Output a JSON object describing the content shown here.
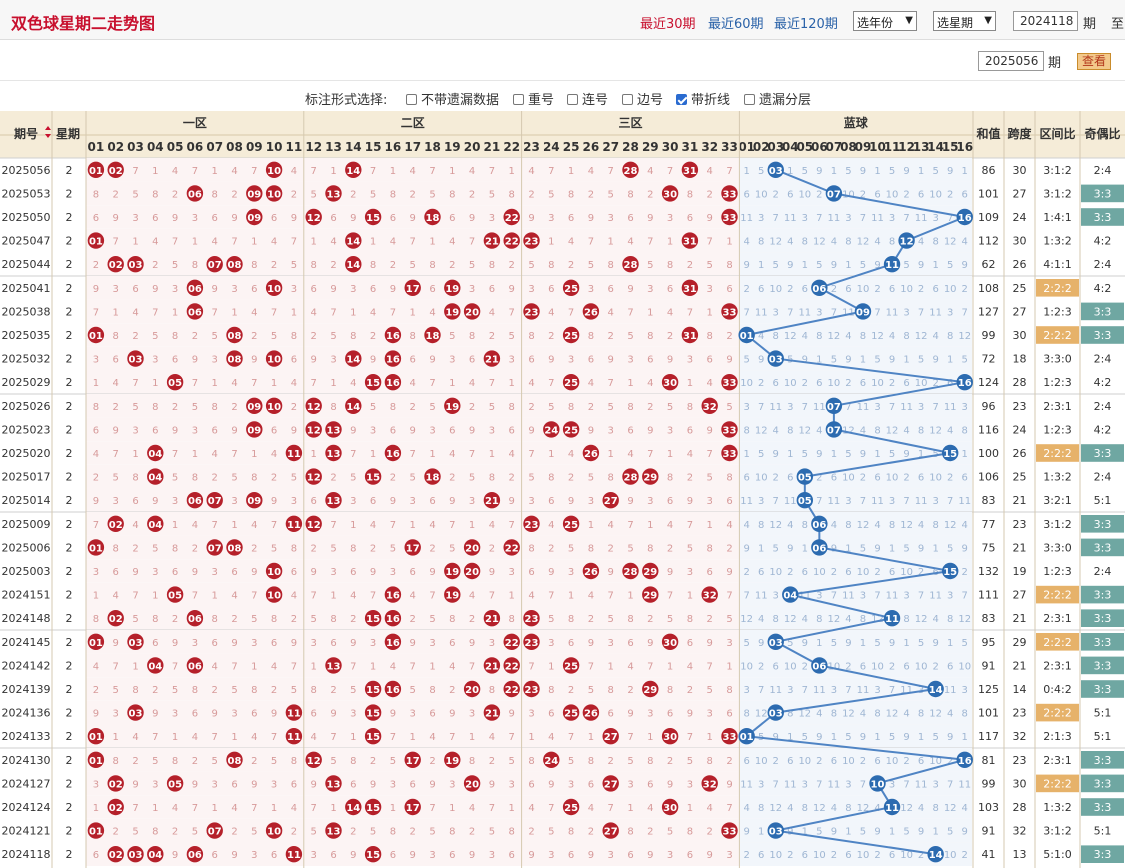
{
  "header": {
    "title": "双色球星期二走势图",
    "range_links": [
      "最近30期",
      "最近60期",
      "最近120期"
    ],
    "year_select": "选年份",
    "weekday_select": "选星期",
    "start_issue": "2024118",
    "issue_suffix": "期",
    "to_label": "至",
    "end_issue": "2025056",
    "view_button": "查看"
  },
  "options": {
    "label": "标注形式选择:",
    "items": [
      {
        "label": "不带遗漏数据",
        "checked": false
      },
      {
        "label": "重号",
        "checked": false
      },
      {
        "label": "连号",
        "checked": false
      },
      {
        "label": "边号",
        "checked": false
      },
      {
        "label": "带折线",
        "checked": true
      },
      {
        "label": "遗漏分层",
        "checked": false
      }
    ]
  },
  "table": {
    "headers": {
      "issue": "期号",
      "weekday": "星期",
      "zone1": "一区",
      "zone2": "二区",
      "zone3": "三区",
      "blue": "蓝球",
      "sum": "和值",
      "span": "跨度",
      "zone_ratio": "区间比",
      "odd_even": "奇偶比"
    },
    "red_columns": [
      "01",
      "02",
      "03",
      "04",
      "05",
      "06",
      "07",
      "08",
      "09",
      "10",
      "11",
      "12",
      "13",
      "14",
      "15",
      "16",
      "17",
      "18",
      "19",
      "20",
      "21",
      "22",
      "23",
      "24",
      "25",
      "26",
      "27",
      "28",
      "29",
      "30",
      "31",
      "32",
      "33"
    ],
    "blue_columns": [
      "01",
      "02",
      "03",
      "04",
      "05",
      "06",
      "07",
      "08",
      "09",
      "10",
      "11",
      "12",
      "13",
      "14",
      "15",
      "16"
    ],
    "rows": [
      {
        "issue": "2025056",
        "weekday": "2",
        "red": [
          1,
          2,
          10,
          14,
          28,
          31
        ],
        "blue": 3,
        "sum": "86",
        "span": "30",
        "zone": "3:1:2",
        "oe": "2:4"
      },
      {
        "issue": "2025053",
        "weekday": "2",
        "red": [
          6,
          9,
          10,
          13,
          30,
          33
        ],
        "blue": 7,
        "sum": "101",
        "span": "27",
        "zone": "3:1:2",
        "oe": "3:3"
      },
      {
        "issue": "2025050",
        "weekday": "2",
        "red": [
          9,
          12,
          15,
          18,
          22,
          33
        ],
        "blue": 16,
        "sum": "109",
        "span": "24",
        "zone": "1:4:1",
        "oe": "3:3"
      },
      {
        "issue": "2025047",
        "weekday": "2",
        "red": [
          1,
          14,
          21,
          22,
          23,
          31
        ],
        "blue": 12,
        "sum": "112",
        "span": "30",
        "zone": "1:3:2",
        "oe": "4:2"
      },
      {
        "issue": "2025044",
        "weekday": "2",
        "red": [
          2,
          3,
          7,
          8,
          14,
          28
        ],
        "blue": 11,
        "sum": "62",
        "span": "26",
        "zone": "4:1:1",
        "oe": "2:4"
      },
      {
        "issue": "2025041",
        "weekday": "2",
        "red": [
          6,
          10,
          17,
          19,
          25,
          31
        ],
        "blue": 6,
        "sum": "108",
        "span": "25",
        "zone": "2:2:2",
        "oe": "4:2"
      },
      {
        "issue": "2025038",
        "weekday": "2",
        "red": [
          6,
          19,
          20,
          23,
          26,
          33
        ],
        "blue": 9,
        "sum": "127",
        "span": "27",
        "zone": "1:2:3",
        "oe": "3:3"
      },
      {
        "issue": "2025035",
        "weekday": "2",
        "red": [
          1,
          8,
          16,
          18,
          25,
          31
        ],
        "blue": 1,
        "sum": "99",
        "span": "30",
        "zone": "2:2:2",
        "oe": "3:3"
      },
      {
        "issue": "2025032",
        "weekday": "2",
        "red": [
          3,
          8,
          10,
          14,
          16,
          21
        ],
        "blue": 3,
        "sum": "72",
        "span": "18",
        "zone": "3:3:0",
        "oe": "2:4"
      },
      {
        "issue": "2025029",
        "weekday": "2",
        "red": [
          5,
          15,
          16,
          25,
          30,
          33
        ],
        "blue": 16,
        "sum": "124",
        "span": "28",
        "zone": "1:2:3",
        "oe": "4:2"
      },
      {
        "issue": "2025026",
        "weekday": "2",
        "red": [
          9,
          10,
          12,
          14,
          19,
          32
        ],
        "blue": 7,
        "sum": "96",
        "span": "23",
        "zone": "2:3:1",
        "oe": "2:4"
      },
      {
        "issue": "2025023",
        "weekday": "2",
        "red": [
          9,
          12,
          13,
          24,
          25,
          33
        ],
        "blue": 7,
        "sum": "116",
        "span": "24",
        "zone": "1:2:3",
        "oe": "4:2"
      },
      {
        "issue": "2025020",
        "weekday": "2",
        "red": [
          4,
          11,
          13,
          16,
          26,
          33
        ],
        "blue": 15,
        "sum": "100",
        "span": "26",
        "zone": "2:2:2",
        "oe": "3:3"
      },
      {
        "issue": "2025017",
        "weekday": "2",
        "red": [
          4,
          12,
          15,
          18,
          28,
          29
        ],
        "blue": 5,
        "sum": "106",
        "span": "25",
        "zone": "1:3:2",
        "oe": "2:4"
      },
      {
        "issue": "2025014",
        "weekday": "2",
        "red": [
          6,
          7,
          9,
          13,
          21,
          27
        ],
        "blue": 5,
        "sum": "83",
        "span": "21",
        "zone": "3:2:1",
        "oe": "5:1"
      },
      {
        "issue": "2025009",
        "weekday": "2",
        "red": [
          2,
          4,
          11,
          12,
          23,
          25
        ],
        "blue": 6,
        "sum": "77",
        "span": "23",
        "zone": "3:1:2",
        "oe": "3:3"
      },
      {
        "issue": "2025006",
        "weekday": "2",
        "red": [
          1,
          7,
          8,
          17,
          20,
          22
        ],
        "blue": 6,
        "sum": "75",
        "span": "21",
        "zone": "3:3:0",
        "oe": "3:3"
      },
      {
        "issue": "2025003",
        "weekday": "2",
        "red": [
          10,
          19,
          20,
          26,
          28,
          29
        ],
        "blue": 15,
        "sum": "132",
        "span": "19",
        "zone": "1:2:3",
        "oe": "2:4"
      },
      {
        "issue": "2024151",
        "weekday": "2",
        "red": [
          5,
          10,
          16,
          19,
          29,
          32
        ],
        "blue": 4,
        "sum": "111",
        "span": "27",
        "zone": "2:2:2",
        "oe": "3:3"
      },
      {
        "issue": "2024148",
        "weekday": "2",
        "red": [
          2,
          6,
          15,
          16,
          21,
          23
        ],
        "blue": 11,
        "sum": "83",
        "span": "21",
        "zone": "2:3:1",
        "oe": "3:3"
      },
      {
        "issue": "2024145",
        "weekday": "2",
        "red": [
          1,
          3,
          16,
          22,
          23,
          30
        ],
        "blue": 3,
        "sum": "95",
        "span": "29",
        "zone": "2:2:2",
        "oe": "3:3"
      },
      {
        "issue": "2024142",
        "weekday": "2",
        "red": [
          4,
          6,
          13,
          21,
          22,
          25
        ],
        "blue": 6,
        "sum": "91",
        "span": "21",
        "zone": "2:3:1",
        "oe": "3:3"
      },
      {
        "issue": "2024139",
        "weekday": "2",
        "red": [
          15,
          16,
          20,
          22,
          23,
          29
        ],
        "blue": 14,
        "sum": "125",
        "span": "14",
        "zone": "0:4:2",
        "oe": "3:3"
      },
      {
        "issue": "2024136",
        "weekday": "2",
        "red": [
          3,
          11,
          15,
          21,
          25,
          26
        ],
        "blue": 3,
        "sum": "101",
        "span": "23",
        "zone": "2:2:2",
        "oe": "5:1"
      },
      {
        "issue": "2024133",
        "weekday": "2",
        "red": [
          1,
          11,
          15,
          27,
          30,
          33
        ],
        "blue": 1,
        "sum": "117",
        "span": "32",
        "zone": "2:1:3",
        "oe": "5:1"
      },
      {
        "issue": "2024130",
        "weekday": "2",
        "red": [
          1,
          12,
          17,
          19,
          24,
          8
        ],
        "blue": 16,
        "sum": "81",
        "span": "23",
        "zone": "2:3:1",
        "oe": "3:3"
      },
      {
        "issue": "2024127",
        "weekday": "2",
        "red": [
          5,
          13,
          20,
          27,
          32,
          2
        ],
        "blue": 10,
        "sum": "99",
        "span": "30",
        "zone": "2:2:2",
        "oe": "3:3"
      },
      {
        "issue": "2024124",
        "weekday": "2",
        "red": [
          2,
          14,
          15,
          17,
          25,
          30
        ],
        "blue": 11,
        "sum": "103",
        "span": "28",
        "zone": "1:3:2",
        "oe": "3:3"
      },
      {
        "issue": "2024121",
        "weekday": "2",
        "red": [
          1,
          7,
          10,
          13,
          27,
          33
        ],
        "blue": 3,
        "sum": "91",
        "span": "32",
        "zone": "3:1:2",
        "oe": "5:1"
      },
      {
        "issue": "2024118",
        "weekday": "2",
        "red": [
          2,
          3,
          4,
          6,
          11,
          15
        ],
        "blue": 14,
        "sum": "41",
        "span": "13",
        "zone": "5:1:0",
        "oe": "3:3"
      }
    ]
  },
  "colors": {
    "red_ball": "#b5202a",
    "blue_ball": "#2c6bb0",
    "blue_line": "#4f84c4",
    "header_bg": "#f5ecd8",
    "badge_orange": "#e6b26a",
    "badge_teal": "#6fa7a2"
  }
}
